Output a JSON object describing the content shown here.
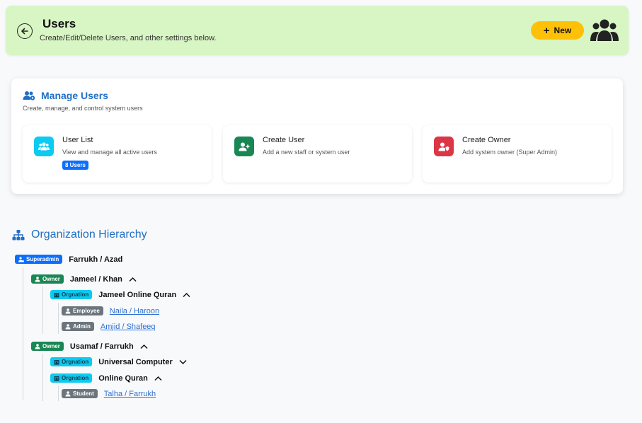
{
  "header": {
    "title": "Users",
    "subtitle": "Create/Edit/Delete Users, and other settings below.",
    "new_label": "New"
  },
  "manage": {
    "title": "Manage Users",
    "subtitle": "Create, manage, and control system users",
    "actions": [
      {
        "title": "User List",
        "subtitle": "View and manage all active users",
        "badge": "8 Users",
        "icon": "users-icon",
        "color": "#0dcaf0"
      },
      {
        "title": "Create User",
        "subtitle": "Add a new staff or system user",
        "icon": "user-plus-icon",
        "color": "#198754"
      },
      {
        "title": "Create Owner",
        "subtitle": "Add system owner (Super Admin)",
        "icon": "user-shield-icon",
        "color": "#dc3545"
      }
    ]
  },
  "org": {
    "title": "Organization Hierarchy",
    "superadmin": {
      "badge": "Superadmin",
      "name": "Farrukh / Azad"
    },
    "owners": [
      {
        "badge": "Owner",
        "name": "Jameel / Khan",
        "expanded": true,
        "orgs": [
          {
            "badge": "Orgnation",
            "name": "Jameel Online Quran",
            "expanded": true,
            "users": [
              {
                "badge": "Employee",
                "name": "Naila / Haroon"
              },
              {
                "badge": "Admin",
                "name": "Amjid / Shafeeq"
              }
            ]
          }
        ]
      },
      {
        "badge": "Owner",
        "name": "Usamaf / Farrukh",
        "expanded": true,
        "orgs": [
          {
            "badge": "Orgnation",
            "name": "Universal Computer",
            "expanded": false,
            "users": []
          },
          {
            "badge": "Orgnation",
            "name": "Online Quran",
            "expanded": true,
            "users": [
              {
                "badge": "Student",
                "name": "Talha / Farrukh"
              }
            ]
          }
        ]
      }
    ]
  },
  "colors": {
    "header_bg": "#d8f5c4",
    "accent": "#1f6fc5",
    "new_button": "#ffc107",
    "superadmin": "#0d6efd",
    "owner": "#198754",
    "org": "#0dcaf0",
    "user": "#6c757d"
  }
}
